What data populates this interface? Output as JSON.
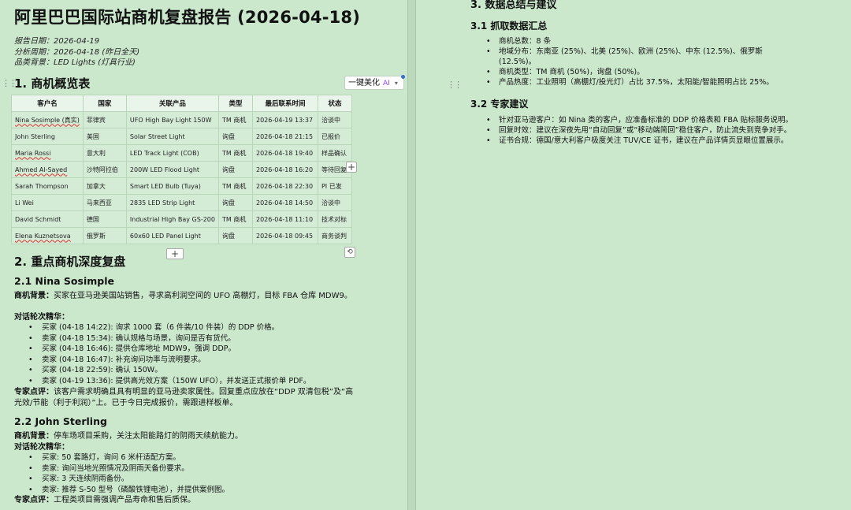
{
  "doc": {
    "title": "阿里巴巴国际站商机复盘报告 (2026-04-18)",
    "meta": [
      "报告日期：2026-04-19",
      "分析周期：2026-04-18 (昨日全天)",
      "品类背景：LED Lights (灯具行业)"
    ]
  },
  "toolbar": {
    "beautify_label": "一键美化",
    "ai_label": "AI"
  },
  "section1": {
    "heading": "1. 商机概览表",
    "columns": [
      "客户名",
      "国家",
      "关联产品",
      "类型",
      "最后联系时间",
      "状态"
    ],
    "rows": [
      [
        "Nina Sosimple (真实)",
        "菲律宾",
        "UFO High Bay Light 150W",
        "TM 商机",
        "2026-04-19 13:37",
        "洽谈中"
      ],
      [
        "John Sterling",
        "美国",
        "Solar Street Light",
        "询盘",
        "2026-04-18 21:15",
        "已报价"
      ],
      [
        "Maria Rossi",
        "意大利",
        "LED Track Light (COB)",
        "TM 商机",
        "2026-04-18 19:40",
        "样品确认"
      ],
      [
        "Ahmed Al-Sayed",
        "沙特阿拉伯",
        "200W LED Flood Light",
        "询盘",
        "2026-04-18 16:20",
        "等待回复"
      ],
      [
        "Sarah Thompson",
        "加拿大",
        "Smart LED Bulb (Tuya)",
        "TM 商机",
        "2026-04-18 22:30",
        "PI 已发"
      ],
      [
        "Li Wei",
        "马来西亚",
        "2835 LED Strip Light",
        "询盘",
        "2026-04-18 14:50",
        "洽谈中"
      ],
      [
        "David Schmidt",
        "德国",
        "Industrial High Bay GS-200",
        "TM 商机",
        "2026-04-18 11:10",
        "技术对标"
      ],
      [
        "Elena Kuznetsova",
        "俄罗斯",
        "60x60 LED Panel Light",
        "询盘",
        "2026-04-18 09:45",
        "商务谈判"
      ]
    ]
  },
  "section2": {
    "heading": "2. 重点商机深度复盘",
    "nina": {
      "heading": "2.1 Nina Sosimple",
      "bg_label": "商机背景：",
      "bg_text": "买家在亚马逊美国站销售，寻求高利润空间的 UFO 高棚灯，目标 FBA 仓库 MDW9。",
      "rounds_label": "对话轮次精华：",
      "rounds": [
        "买家 (04-18 14:22): 询求 1000 套（6 件装/10 件装）的 DDP 价格。",
        "卖家 (04-18 15:34): 确认规格与场景，询问是否有货代。",
        "买家 (04-18 16:46): 提供仓库地址 MDW9，强调 DDP。",
        "卖家 (04-18 16:47): 补充询问功率与流明要求。",
        "买家 (04-18 22:59): 确认 150W。",
        "卖家 (04-19 13:36): 提供高光效方案（150W UFO），并发送正式报价单 PDF。"
      ],
      "comment_label": "专家点评：",
      "comment_text": "该客户需求明确且具有明显的亚马逊卖家属性。回复重点应放在“DDP 双清包税”及“高光效/节能（利于利润）”上。已于今日完成报价，需跟进样板单。"
    },
    "john": {
      "heading": "2.2 John Sterling",
      "bg_label": "商机背景：",
      "bg_text": "停车场项目采购，关注太阳能路灯的阴雨天续航能力。",
      "rounds_label": "对话轮次精华：",
      "rounds": [
        "买家: 50 套路灯，询问 6 米杆适配方案。",
        "卖家: 询问当地光照情况及阴雨天备份要求。",
        "买家: 3 天连续阴雨备份。",
        "卖家: 推荐 S-50 型号（磷酸铁锂电池），并提供案例图。"
      ],
      "comment_label": "专家点评：",
      "comment_text": "工程类项目需强调产品寿命和售后质保。"
    }
  },
  "section3": {
    "heading": "3. 数据总结与建议",
    "stats_heading": "3.1 抓取数据汇总",
    "stats": [
      "商机总数：8 条",
      "地域分布：东南亚 (25%)、北美 (25%)、欧洲 (25%)、中东 (12.5%)、俄罗斯 (12.5%)。",
      "商机类型：TM 商机 (50%)，询盘 (50%)。",
      "产品热度：工业照明（高棚灯/投光灯）占比 37.5%，太阳能/智能照明占比 25%。"
    ],
    "advice_heading": "3.2 专家建议",
    "advice": [
      "针对亚马逊客户：如 Nina 类的客户，应准备标准的 DDP 价格表和 FBA 贴标服务说明。",
      "回复时效：建议在深夜先用“自动回复”或“移动端简回”稳住客户，防止流失到竞争对手。",
      "证书合规：德国/意大利客户极度关注 TUV/CE 证书，建议在产品详情页显眼位置展示。"
    ]
  }
}
